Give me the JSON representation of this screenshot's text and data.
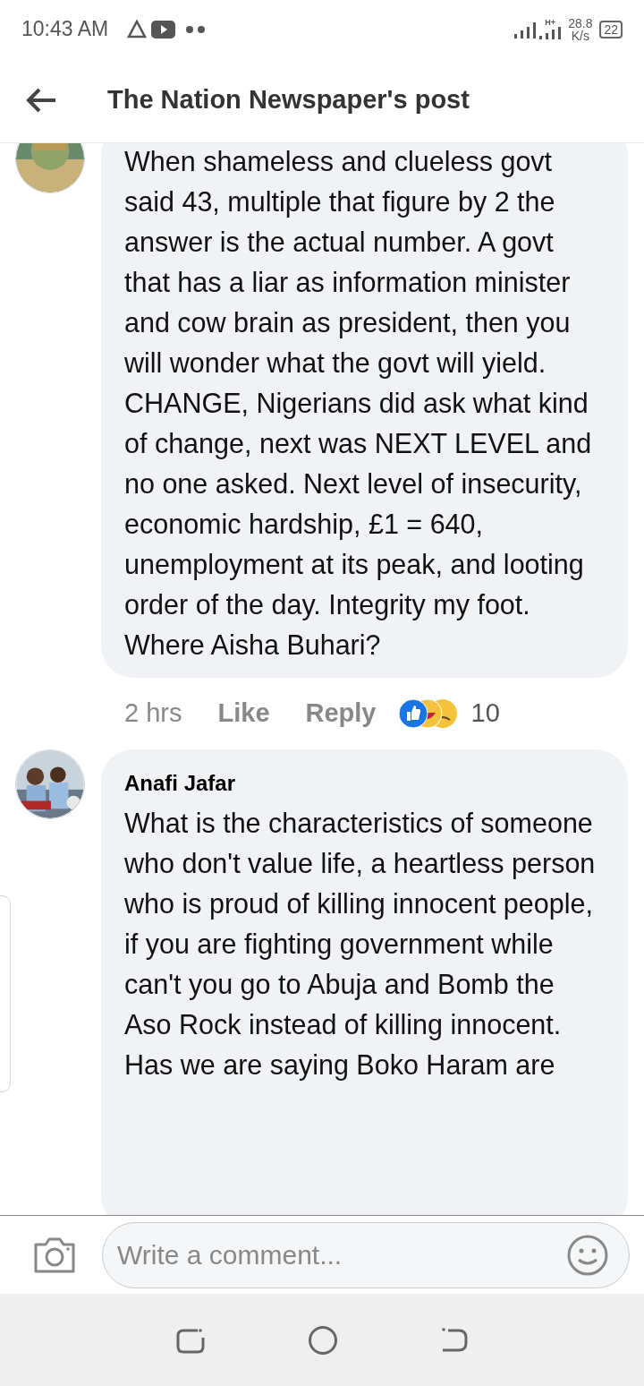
{
  "status_bar": {
    "time": "10:43 AM",
    "network": "H+",
    "speed_value": "28.8",
    "speed_unit": "K/s",
    "battery": "22"
  },
  "header": {
    "title": "The Nation Newspaper's post"
  },
  "comments": [
    {
      "text": "When shameless and clueless govt said 43, multiple that figure by 2 the answer is the actual number. A govt that has a liar as information minister and cow brain as president, then you will wonder what the govt will yield.\nCHANGE, Nigerians did ask what kind of change, next was NEXT LEVEL and no one asked. Next level of insecurity, economic hardship, £1 = 640, unemployment at its peak, and looting order of the day. Integrity my foot. Where Aisha Buhari?",
      "time": "2 hrs",
      "like": "Like",
      "reply": "Reply",
      "reaction_count": "10"
    },
    {
      "author": "Anafi Jafar",
      "text": "What is the characteristics of someone who don't value life, a heartless person who is proud of killing innocent people, if you are fighting government while can't you go to Abuja and Bomb the Aso Rock instead of killing innocent. Has we are saying Boko Haram are"
    }
  ],
  "composer": {
    "placeholder": "Write a comment..."
  }
}
